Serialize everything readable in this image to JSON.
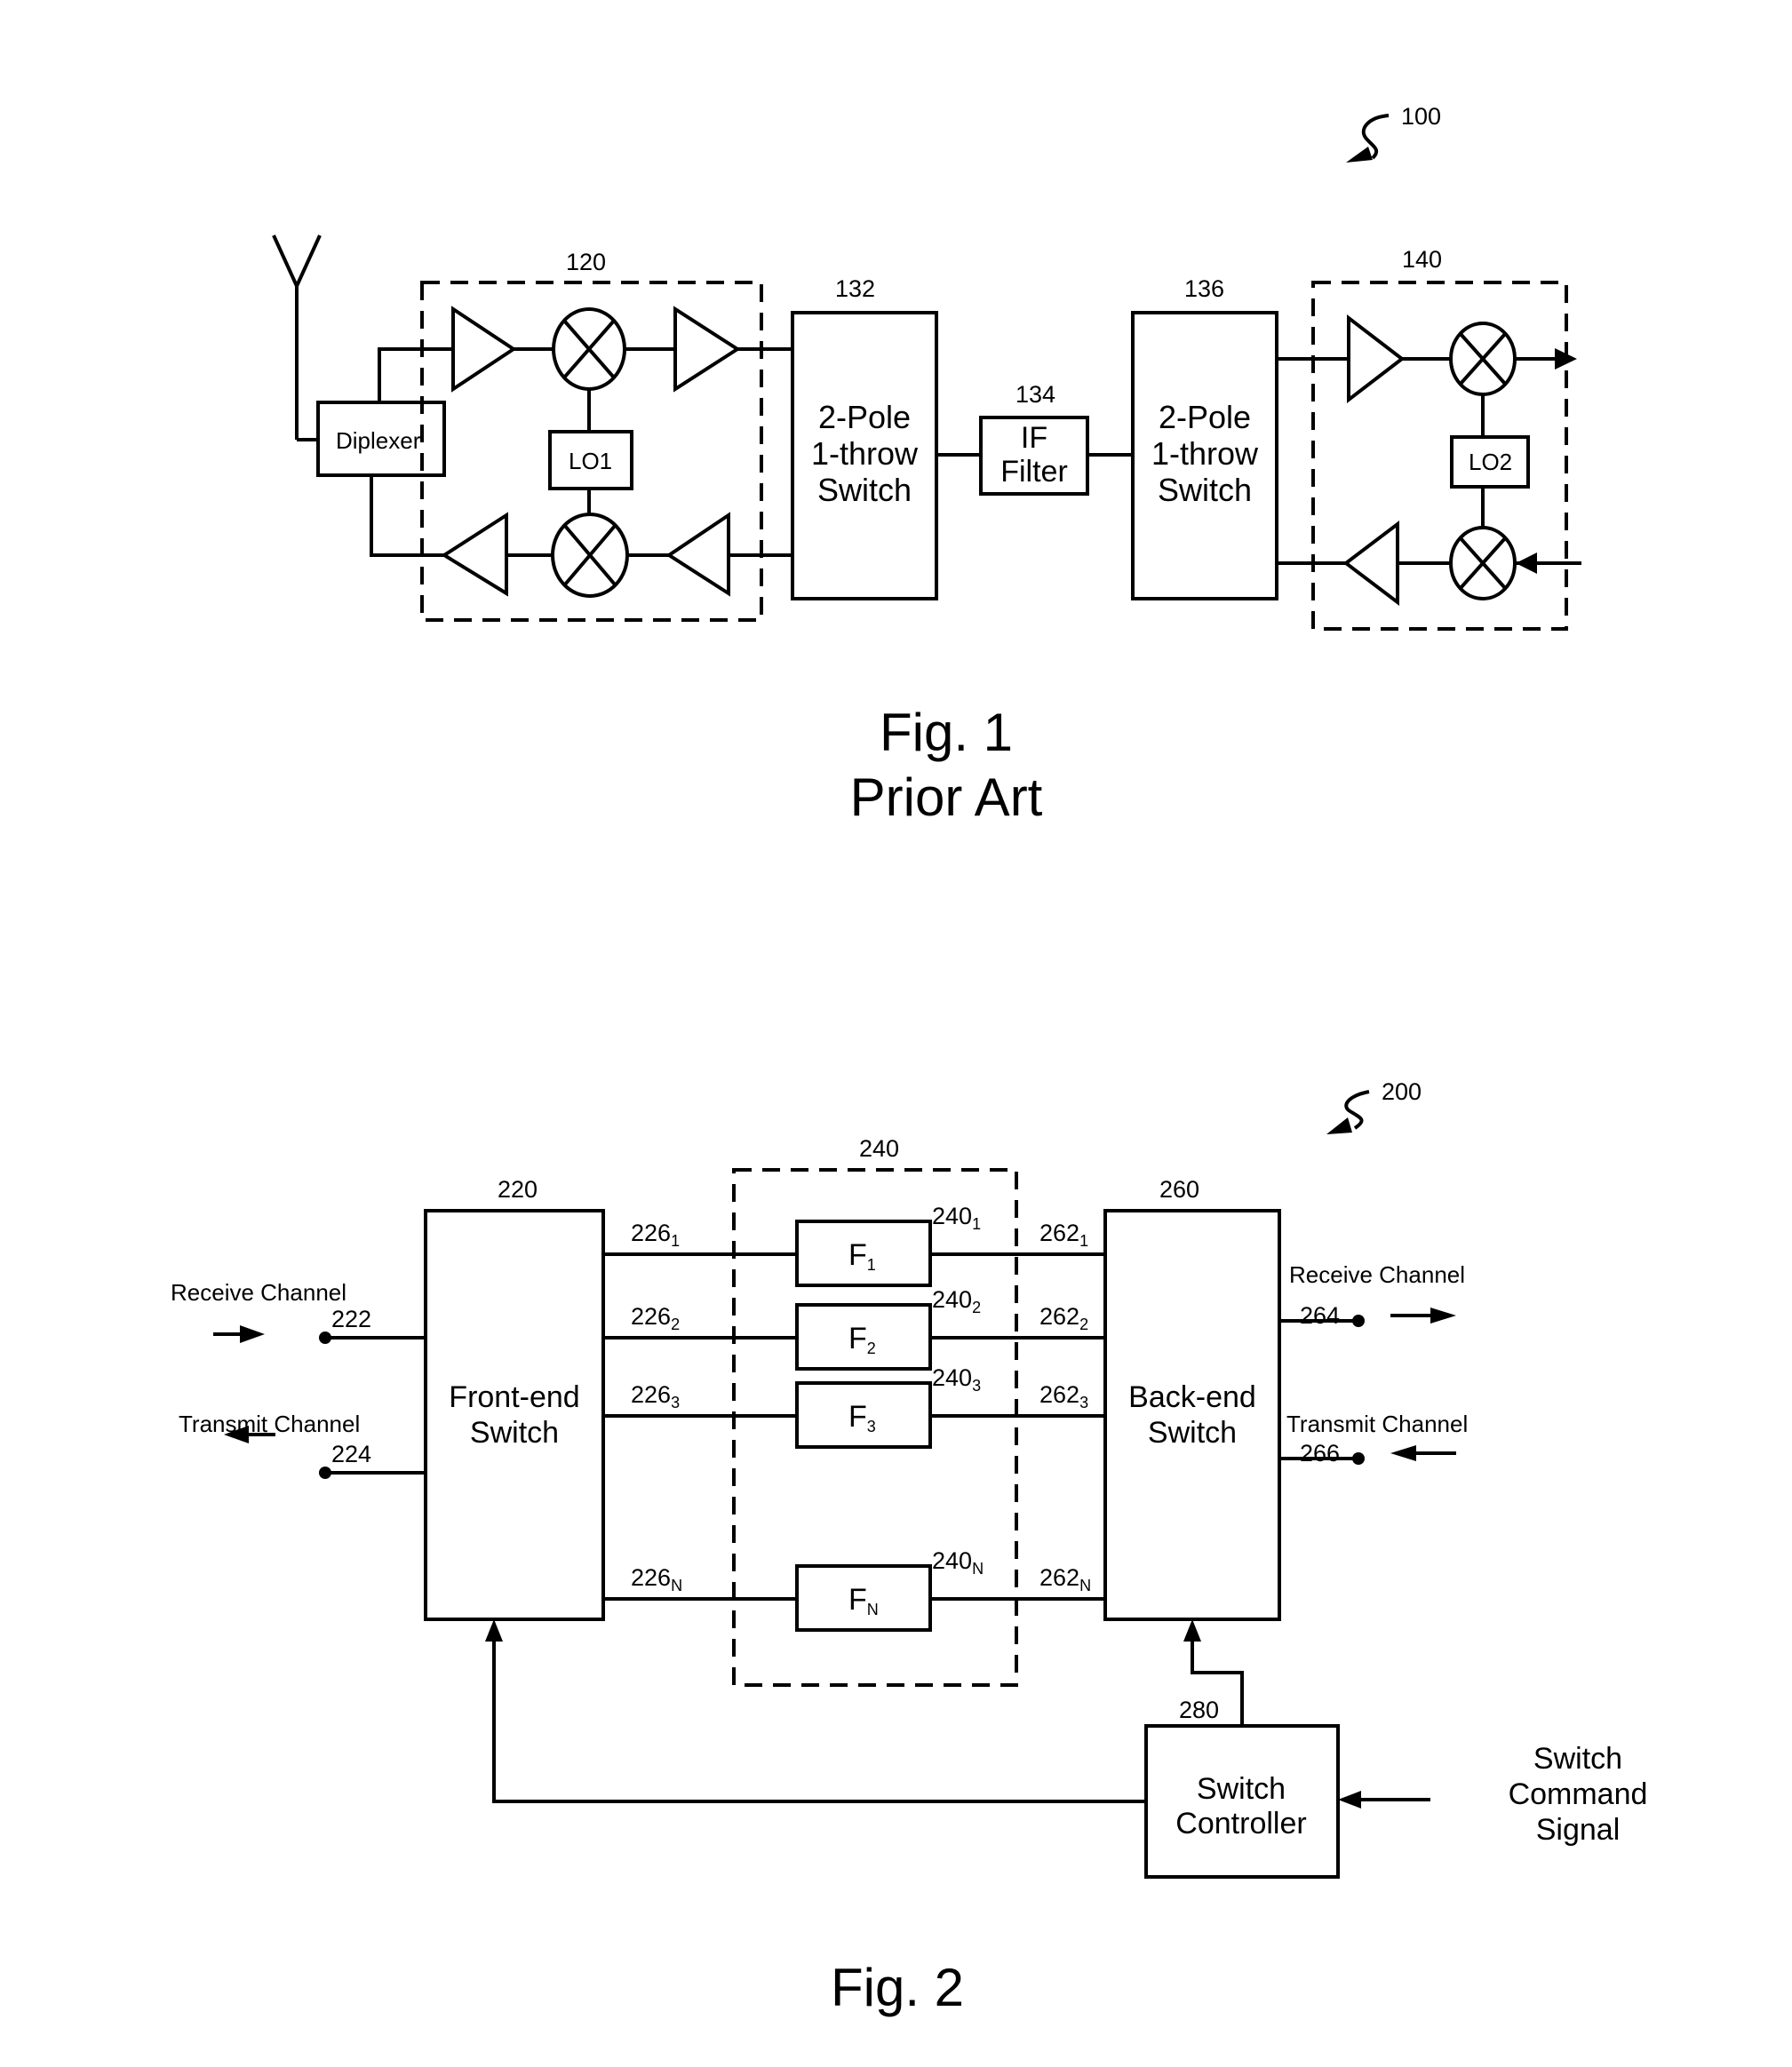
{
  "fig1": {
    "ref": "100",
    "caption": "Fig. 1",
    "caption_sub": "Prior Art",
    "block_120": "120",
    "block_132": "132",
    "block_134": "134",
    "block_136": "136",
    "block_140": "140",
    "diplexer": "Diplexer",
    "lo1": "LO1",
    "lo2": "LO2",
    "switch1": [
      "2-Pole",
      "1-throw",
      "Switch"
    ],
    "if_filter": [
      "IF",
      "Filter"
    ],
    "switch2": [
      "2-Pole",
      "1-throw",
      "Switch"
    ]
  },
  "fig2": {
    "ref": "200",
    "caption": "Fig. 2",
    "front_end_ref": "220",
    "front_end": [
      "Front-end",
      "Switch"
    ],
    "back_end_ref": "260",
    "back_end": [
      "Back-end",
      "Switch"
    ],
    "filter_bank_ref": "240",
    "controller_ref": "280",
    "controller": [
      "Switch",
      "Controller"
    ],
    "command_signal": [
      "Switch",
      "Command",
      "Signal"
    ],
    "left_receive_label": "Receive Channel",
    "left_receive_ref": "222",
    "left_transmit_label": "Transmit Channel",
    "left_transmit_ref": "224",
    "right_receive_label": "Receive Channel",
    "right_receive_ref": "264",
    "right_transmit_label": "Transmit Channel",
    "right_transmit_ref": "266",
    "filters": [
      {
        "name": "F",
        "sub": "1",
        "ref": "240",
        "ref_sub": "1",
        "in_ref": "226",
        "in_sub": "1",
        "out_ref": "262",
        "out_sub": "1"
      },
      {
        "name": "F",
        "sub": "2",
        "ref": "240",
        "ref_sub": "2",
        "in_ref": "226",
        "in_sub": "2",
        "out_ref": "262",
        "out_sub": "2"
      },
      {
        "name": "F",
        "sub": "3",
        "ref": "240",
        "ref_sub": "3",
        "in_ref": "226",
        "in_sub": "3",
        "out_ref": "262",
        "out_sub": "3"
      },
      {
        "name": "F",
        "sub": "N",
        "ref": "240",
        "ref_sub": "N",
        "in_ref": "226",
        "in_sub": "N",
        "out_ref": "262",
        "out_sub": "N"
      }
    ]
  }
}
